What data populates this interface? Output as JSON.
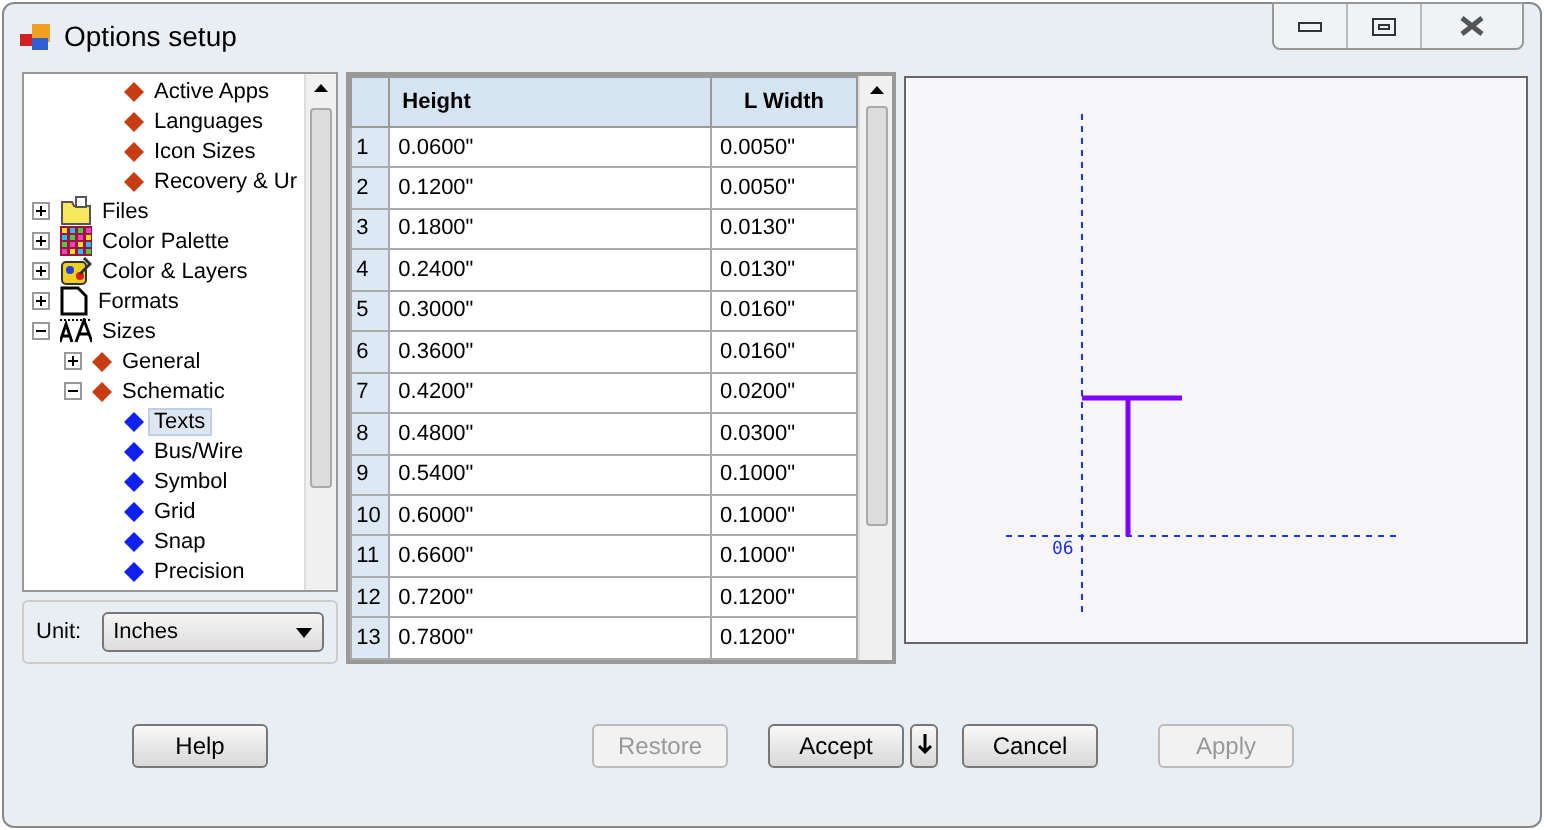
{
  "window": {
    "title": "Options setup"
  },
  "tree": {
    "leading_items": [
      {
        "label": "Active Apps",
        "kind": "diamond-red",
        "selected": false
      },
      {
        "label": "Languages",
        "kind": "diamond-red",
        "selected": false
      },
      {
        "label": "Icon Sizes",
        "kind": "diamond-red",
        "selected": false
      },
      {
        "label": "Recovery & Ur",
        "kind": "diamond-red",
        "selected": false
      }
    ],
    "items": [
      {
        "label": "Files",
        "kind": "folder",
        "expanded": false,
        "selected": false
      },
      {
        "label": "Color Palette",
        "kind": "palette",
        "expanded": false,
        "selected": false
      },
      {
        "label": "Color & Layers",
        "kind": "layers",
        "expanded": false,
        "selected": false
      },
      {
        "label": "Formats",
        "kind": "document",
        "expanded": false,
        "selected": false
      },
      {
        "label": "Sizes",
        "kind": "sizes",
        "expanded": true,
        "selected": false,
        "children": [
          {
            "label": "General",
            "kind": "diamond-red",
            "expanded": false,
            "selected": false
          },
          {
            "label": "Schematic",
            "kind": "diamond-red",
            "expanded": true,
            "selected": false,
            "children": [
              {
                "label": "Texts",
                "kind": "diamond-blue",
                "selected": true
              },
              {
                "label": "Bus/Wire",
                "kind": "diamond-blue",
                "selected": false
              },
              {
                "label": "Symbol",
                "kind": "diamond-blue",
                "selected": false
              },
              {
                "label": "Grid",
                "kind": "diamond-blue",
                "selected": false
              },
              {
                "label": "Snap",
                "kind": "diamond-blue",
                "selected": false
              },
              {
                "label": "Precision",
                "kind": "diamond-blue",
                "selected": false
              }
            ]
          }
        ]
      }
    ]
  },
  "unit": {
    "label": "Unit:",
    "value": "Inches"
  },
  "table": {
    "columns": [
      "",
      "Height",
      "L Width"
    ],
    "rows": [
      [
        "1",
        "0.0600\"",
        "0.0050\""
      ],
      [
        "2",
        "0.1200\"",
        "0.0050\""
      ],
      [
        "3",
        "0.1800\"",
        "0.0130\""
      ],
      [
        "4",
        "0.2400\"",
        "0.0130\""
      ],
      [
        "5",
        "0.3000\"",
        "0.0160\""
      ],
      [
        "6",
        "0.3600\"",
        "0.0160\""
      ],
      [
        "7",
        "0.4200\"",
        "0.0200\""
      ],
      [
        "8",
        "0.4800\"",
        "0.0300\""
      ],
      [
        "9",
        "0.5400\"",
        "0.1000\""
      ],
      [
        "10",
        "0.6000\"",
        "0.1000\""
      ],
      [
        "11",
        "0.6600\"",
        "0.1000\""
      ],
      [
        "12",
        "0.7200\"",
        "0.1200\""
      ],
      [
        "13",
        "0.7800\"",
        "0.1200\""
      ]
    ]
  },
  "preview": {
    "origin_label": "06"
  },
  "buttons": [
    {
      "label": "Help",
      "kind": "normal",
      "disabled": false
    },
    {
      "label": "Restore",
      "kind": "normal",
      "disabled": true
    },
    {
      "label": "Accept",
      "kind": "split",
      "disabled": false
    },
    {
      "label": "Cancel",
      "kind": "normal",
      "disabled": false
    },
    {
      "label": "Apply",
      "kind": "normal",
      "disabled": true
    }
  ]
}
